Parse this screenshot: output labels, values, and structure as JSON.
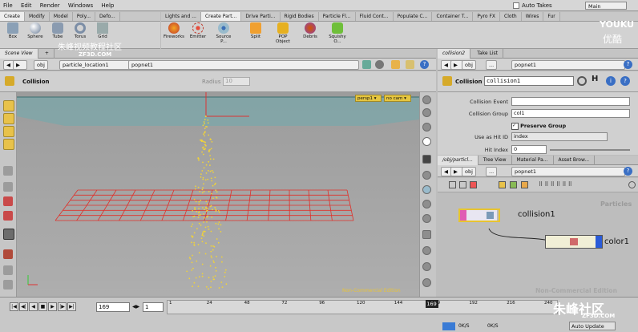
{
  "menu": [
    "File",
    "Edit",
    "Render",
    "Windows",
    "Help"
  ],
  "auto_takes": "Auto Takes",
  "desktop": "Main",
  "shelf_tabs_left": [
    "Create",
    "Modify",
    "Model",
    "Poly...",
    "Defo..."
  ],
  "shelf_tabs_right": [
    "Lights and ...",
    "Create Part...",
    "Drive Parti...",
    "Rigid Bodies",
    "Particle Fl...",
    "Fluid Cont...",
    "Populate C...",
    "Container T...",
    "Pyro FX",
    "Cloth",
    "Wires",
    "Fur"
  ],
  "tools_left": [
    "Box",
    "Sphere",
    "Tube",
    "Torus",
    "Grid"
  ],
  "tools_right": [
    "Fireworks",
    "Emitter",
    "Source P...",
    "Split",
    "POP Object",
    "Debris",
    "Squishy O..."
  ],
  "viewer": {
    "tabs": [
      "Scene View"
    ],
    "path": [
      "obj",
      "particle_location1"
    ],
    "node": "popnet1",
    "state_title": "Collision",
    "radius_label": "Radius",
    "radius_value": "10",
    "persp": "persp1 ▾",
    "cam": "no cam ▾",
    "nc_label": "Non-Commercial Edition"
  },
  "params": {
    "tabs": [
      "collision2",
      "Take List"
    ],
    "path": [
      "obj",
      "..."
    ],
    "node": "popnet1",
    "type_label": "Collision",
    "node_name": "collision1",
    "rows": [
      {
        "label": "Collision Event",
        "value": ""
      },
      {
        "label": "Collision Group",
        "value": "col1"
      }
    ],
    "preserve_group": "Preserve Group",
    "hit_id_label": "Use as Hit ID",
    "hit_id_value": "index",
    "hit_index_label": "Hit Index",
    "hit_index_value": "0"
  },
  "network": {
    "tabs": [
      "/obj/particl...",
      "Tree View",
      "Material Pa...",
      "Asset Brow..."
    ],
    "path": [
      "obj",
      "..."
    ],
    "node": "popnet1",
    "context": "Particles",
    "nodes": [
      "collision1",
      "color1"
    ],
    "nc_label": "Non-Commercial Edition"
  },
  "timeline": {
    "frame": "169",
    "step": "1",
    "ticks": [
      "1",
      "24",
      "48",
      "72",
      "96",
      "120",
      "144",
      "169",
      "192",
      "216",
      "240"
    ],
    "current": "169",
    "current_fraction": 0.7,
    "auto_update": "Auto Update",
    "status": [
      "0K/S",
      "0K/S"
    ]
  },
  "watermarks": {
    "top": "朱峰视频教程社区",
    "site": "ZF3D.COM",
    "youku": "YOUKU",
    "youku_cn": "优酷",
    "bottom": "朱峰社区",
    "bottom_site": "ZF3D.COM"
  }
}
